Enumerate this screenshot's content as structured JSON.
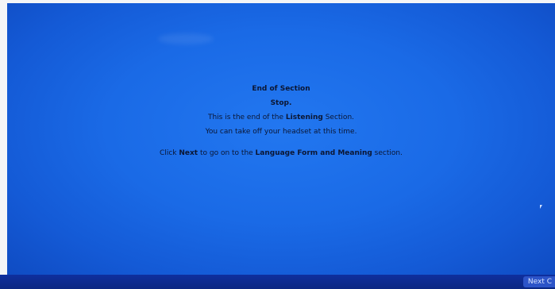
{
  "message": {
    "heading": "End of Section",
    "stop": "Stop.",
    "line3_pre": "This is the end of the ",
    "line3_strong": "Listening",
    "line3_post": " Section.",
    "line4": "You can take off your headset at this time.",
    "line5_pre": "Click ",
    "line5_strong1": "Next",
    "line5_mid": " to go on to the ",
    "line5_strong2": "Language Form and Meaning",
    "line5_post": " section."
  },
  "toolbar": {
    "next_label": "Next C"
  }
}
